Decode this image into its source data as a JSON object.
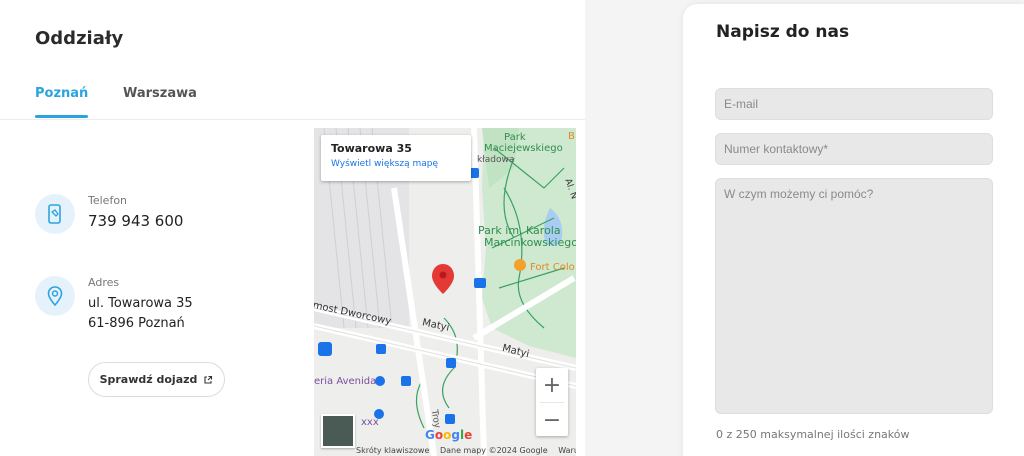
{
  "branches": {
    "title": "Oddziały",
    "tabs": [
      {
        "label": "Poznań",
        "active": true
      },
      {
        "label": "Warszawa",
        "active": false
      }
    ],
    "phone": {
      "label": "Telefon",
      "value": "739 943 600",
      "icon": "phone-icon"
    },
    "address": {
      "label": "Adres",
      "line1": "ul. Towarowa 35",
      "line2": "61-896 Poznań",
      "icon": "location-pin-icon"
    },
    "route_button": "Sprawdź dojazd",
    "accent": "#2aa4e0"
  },
  "map": {
    "card_title": "Towarowa 35",
    "card_link": "Wyświetl większą mapę",
    "labels": {
      "park1": "Park",
      "park2": "Maciejewskiego",
      "kladowa": "kładowa",
      "park_main1": "Park im. Karola",
      "park_main2": "Marcinkowskiego",
      "fort": "Fort Colo",
      "dworcowy": "most Dworcowy",
      "matyi1": "Matyi",
      "matyi2": "Matyi",
      "avenida": "eria Avenida",
      "xx": "xxx",
      "troy": "Troy",
      "al": "Al. N",
      "b": "B"
    },
    "google": "Google",
    "footer": [
      "Skróty klawiszowe",
      "Dane mapy ©2024 Google",
      "Warunki"
    ],
    "zoom_in": "+",
    "zoom_out": "−"
  },
  "contact_form": {
    "title": "Napisz do nas",
    "email_placeholder": "E-mail",
    "phone_placeholder": "Numer kontaktowy*",
    "message_placeholder": "W czym możemy ci pomóc?",
    "counter": "0 z 250 maksymalnej ilości znaków"
  }
}
